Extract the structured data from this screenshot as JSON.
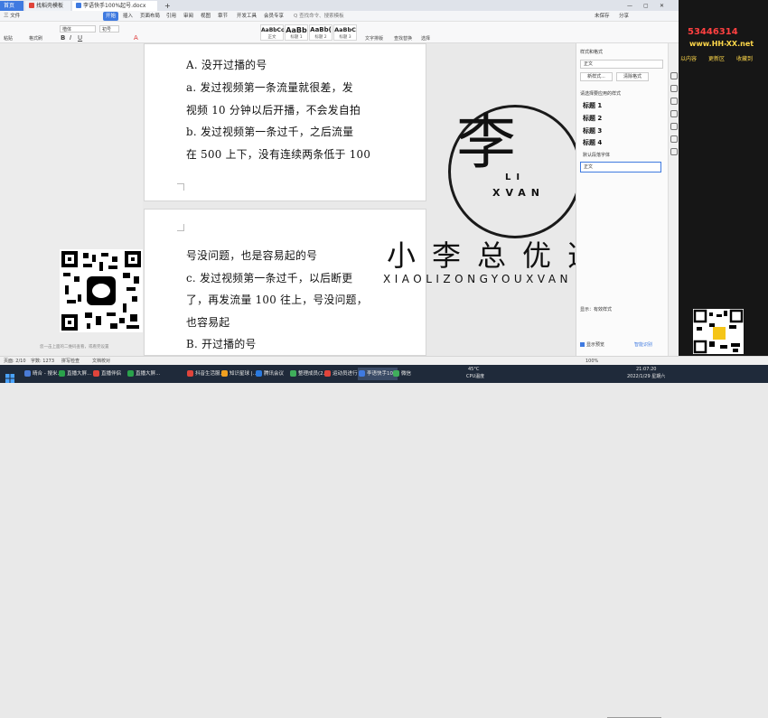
{
  "tabs": {
    "home": "首页",
    "tab1": "找稻壳模板",
    "tab2": "李语快手100%起号.docx",
    "add": "+"
  },
  "window_buttons": {
    "minimize": "—",
    "maximize": "▢",
    "close": "✕"
  },
  "menu": {
    "file": "三 文件",
    "items": [
      "开始",
      "插入",
      "页面布局",
      "引用",
      "审阅",
      "视图",
      "章节",
      "开发工具",
      "会员专享"
    ],
    "search": "Q 查找命令、搜索模板",
    "share": "分享",
    "unsaved": "未保存"
  },
  "ribbon": {
    "paste": "粘贴",
    "format_painter": "格式刷",
    "font_name": "楷体",
    "font_size": "初号",
    "styles": [
      {
        "preview": "AaBbCcDd",
        "label": "正文"
      },
      {
        "preview": "AaBb",
        "label": "标题 1"
      },
      {
        "preview": "AaBb(",
        "label": "标题 2"
      },
      {
        "preview": "AaBbC",
        "label": "标题 3"
      }
    ],
    "text_layout": "文字排版",
    "find_replace": "查找替换",
    "select": "选择"
  },
  "document": {
    "page1_lines": [
      "A. 没开过播的号",
      "a.  发过视频第一条流量就很差，发",
      "视频 10 分钟以后开播，不会发自拍",
      "b.  发过视频第一条过千，之后流量",
      "在 500 上下，没有连续两条低于 100"
    ],
    "page2_lines": [
      "号没问题，也是容易起的号",
      "c.  发过视频第一条过千，以后断更",
      "了，再发流量 100 往上，号没问题，",
      "也容易起",
      "B. 开过播的号"
    ]
  },
  "watermark": {
    "logo_top": "李",
    "logo_mid": "LI",
    "logo_bottom": "XVAN",
    "brand_cn": "小李总优选",
    "brand_en": "XIAOLIZONGYOUXVAN"
  },
  "left_panel": {
    "hint": "您一击上面的二维码查看，或看完设置"
  },
  "right_panel": {
    "title": "样式和格式",
    "current_style": "正文",
    "new_style": "新样式...",
    "clear_format": "清除格式",
    "apply_label": "请选择要应用的样式",
    "styles": [
      "标题 1",
      "标题 2",
      "标题 3",
      "标题 4"
    ],
    "default_font": "默认段落字体",
    "body": "正文",
    "show_label": "显示：有效样式",
    "preview_checkbox": "显示预览",
    "smart_recognize": "智能识别"
  },
  "far_right": {
    "number": "53446314",
    "site": "www.HH-XX.net",
    "links": [
      "以内容",
      "更新区",
      "收藏到"
    ]
  },
  "status": {
    "page": "页面: 2/10",
    "words": "字数: 1273",
    "spell": "拼写检查",
    "doc_verify": "文档校对",
    "zoom": "100%"
  },
  "taskbar": {
    "items": [
      {
        "label": "晴合 - 搜米...",
        "color": "#4a7bd6"
      },
      {
        "label": "直播大屏...",
        "color": "#2aa24b"
      },
      {
        "label": "直播伴侣",
        "color": "#e0443b"
      },
      {
        "label": "直播大屏...",
        "color": "#2aa24b"
      },
      {
        "label": "抖音生活服...",
        "color": "#e0443b"
      },
      {
        "label": "知识星球 |...",
        "color": "#f0a020"
      },
      {
        "label": "腾讯会议",
        "color": "#2a7ae0"
      },
      {
        "label": "整理成员(2...",
        "color": "#3fae5b"
      },
      {
        "label": "运动员进行...",
        "color": "#e0443b"
      },
      {
        "label": "李语快手10...",
        "color": "#3f7ae0"
      },
      {
        "label": "微信",
        "color": "#3fae5b"
      }
    ],
    "temp": "45°C",
    "cpu": "CPU温度",
    "time": "21:07:20",
    "date": "2022/1/29 星期六"
  }
}
